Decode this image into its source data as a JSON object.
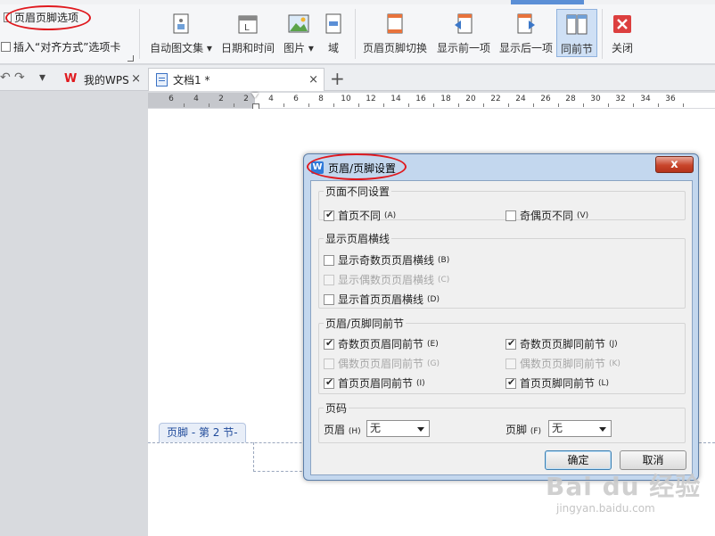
{
  "colors": {
    "accent": "#5b8fd6",
    "annotation": "#e0191e"
  },
  "ribbon": {
    "options_label": "页眉页脚选项",
    "insert_align_label": "插入“对齐方式”选项卡",
    "items": [
      {
        "label": "自动图文集 ▾",
        "icon": "autotext-icon"
      },
      {
        "label": "日期和时间",
        "icon": "calendar-icon"
      },
      {
        "label": "图片 ▾",
        "icon": "picture-icon"
      },
      {
        "label": "域",
        "icon": "field-icon"
      },
      {
        "label": "页眉页脚切换",
        "icon": "header-footer-switch-icon"
      },
      {
        "label": "显示前一项",
        "icon": "show-previous-icon"
      },
      {
        "label": "显示后一项",
        "icon": "show-next-icon"
      },
      {
        "label": "同前节",
        "icon": "same-as-previous-icon"
      },
      {
        "label": "关闭",
        "icon": "close-icon"
      }
    ]
  },
  "tabs": [
    {
      "label": "我的WPS",
      "close": "×"
    },
    {
      "label": "文档1 *",
      "close": "×"
    }
  ],
  "ruler": {
    "marks": [
      "6",
      "4",
      "2",
      "2",
      "4",
      "6",
      "8",
      "10",
      "12",
      "14",
      "16",
      "18",
      "20",
      "22",
      "24",
      "26",
      "28",
      "30",
      "32",
      "34",
      "36"
    ]
  },
  "footer_tag": "页脚 - 第 2 节-",
  "dialog": {
    "title": "页眉/页脚设置",
    "close": "x",
    "groups": {
      "different_pages": {
        "label": "页面不同设置",
        "first_page": {
          "text": "首页不同",
          "hotkey": "(A)",
          "checked": true
        },
        "odd_even": {
          "text": "奇偶页不同",
          "hotkey": "(V)",
          "checked": false
        }
      },
      "header_lines": {
        "label": "显示页眉横线",
        "odd": {
          "text": "显示奇数页页眉横线",
          "hotkey": "(B)",
          "checked": false
        },
        "even": {
          "text": "显示偶数页页眉横线",
          "hotkey": "(C)",
          "checked": false,
          "disabled": true
        },
        "first": {
          "text": "显示首页页眉横线",
          "hotkey": "(D)",
          "checked": false
        }
      },
      "same_as_prev": {
        "label": "页眉/页脚同前节",
        "odd_header": {
          "text": "奇数页页眉同前节",
          "hotkey": "(E)",
          "checked": true
        },
        "odd_footer": {
          "text": "奇数页页脚同前节",
          "hotkey": "(J)",
          "checked": true
        },
        "even_header": {
          "text": "偶数页页眉同前节",
          "hotkey": "(G)",
          "checked": false,
          "disabled": true
        },
        "even_footer": {
          "text": "偶数页页脚同前节",
          "hotkey": "(K)",
          "checked": false,
          "disabled": true
        },
        "first_header": {
          "text": "首页页眉同前节",
          "hotkey": "(I)",
          "checked": true
        },
        "first_footer": {
          "text": "首页页脚同前节",
          "hotkey": "(L)",
          "checked": true
        }
      },
      "page_number": {
        "label": "页码",
        "header_label": "页眉",
        "header_hotkey": "(H)",
        "header_value": "无",
        "footer_label": "页脚",
        "footer_hotkey": "(F)",
        "footer_value": "无"
      }
    },
    "ok_label": "确定",
    "cancel_label": "取消"
  },
  "watermark": {
    "main": "Bai du 经验",
    "sub": "jingyan.baidu.com"
  }
}
